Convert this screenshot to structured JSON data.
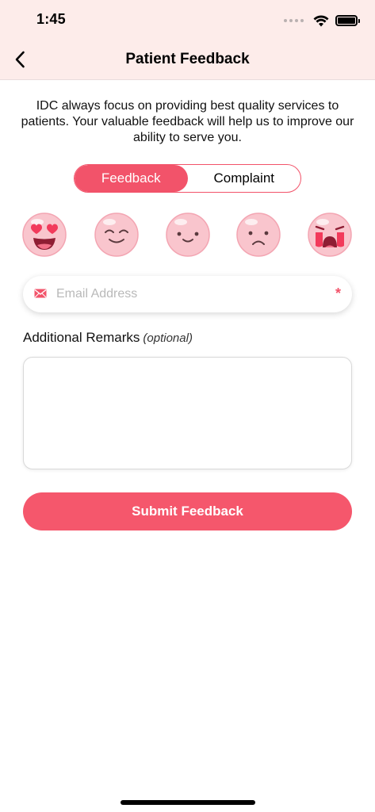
{
  "status_bar": {
    "time": "1:45"
  },
  "header": {
    "title": "Patient Feedback"
  },
  "intro_text": "IDC always focus on providing best quality services to patients. Your valuable feedback will help us to improve our ability to serve you.",
  "segment": {
    "options": [
      "Feedback",
      "Complaint"
    ],
    "selected": "Feedback"
  },
  "ratings": [
    "love",
    "happy",
    "content",
    "sad",
    "crying"
  ],
  "email": {
    "placeholder": "Email Address",
    "value": "",
    "required_mark": "*"
  },
  "remarks": {
    "label": "Additional Remarks",
    "optional_label": "(optional)",
    "value": ""
  },
  "submit": {
    "label": "Submit Feedback"
  },
  "colors": {
    "accent": "#f5576c",
    "header_bg": "#fdecea"
  },
  "icons": {
    "back": "chevron-left-icon",
    "email": "envelope-icon"
  }
}
